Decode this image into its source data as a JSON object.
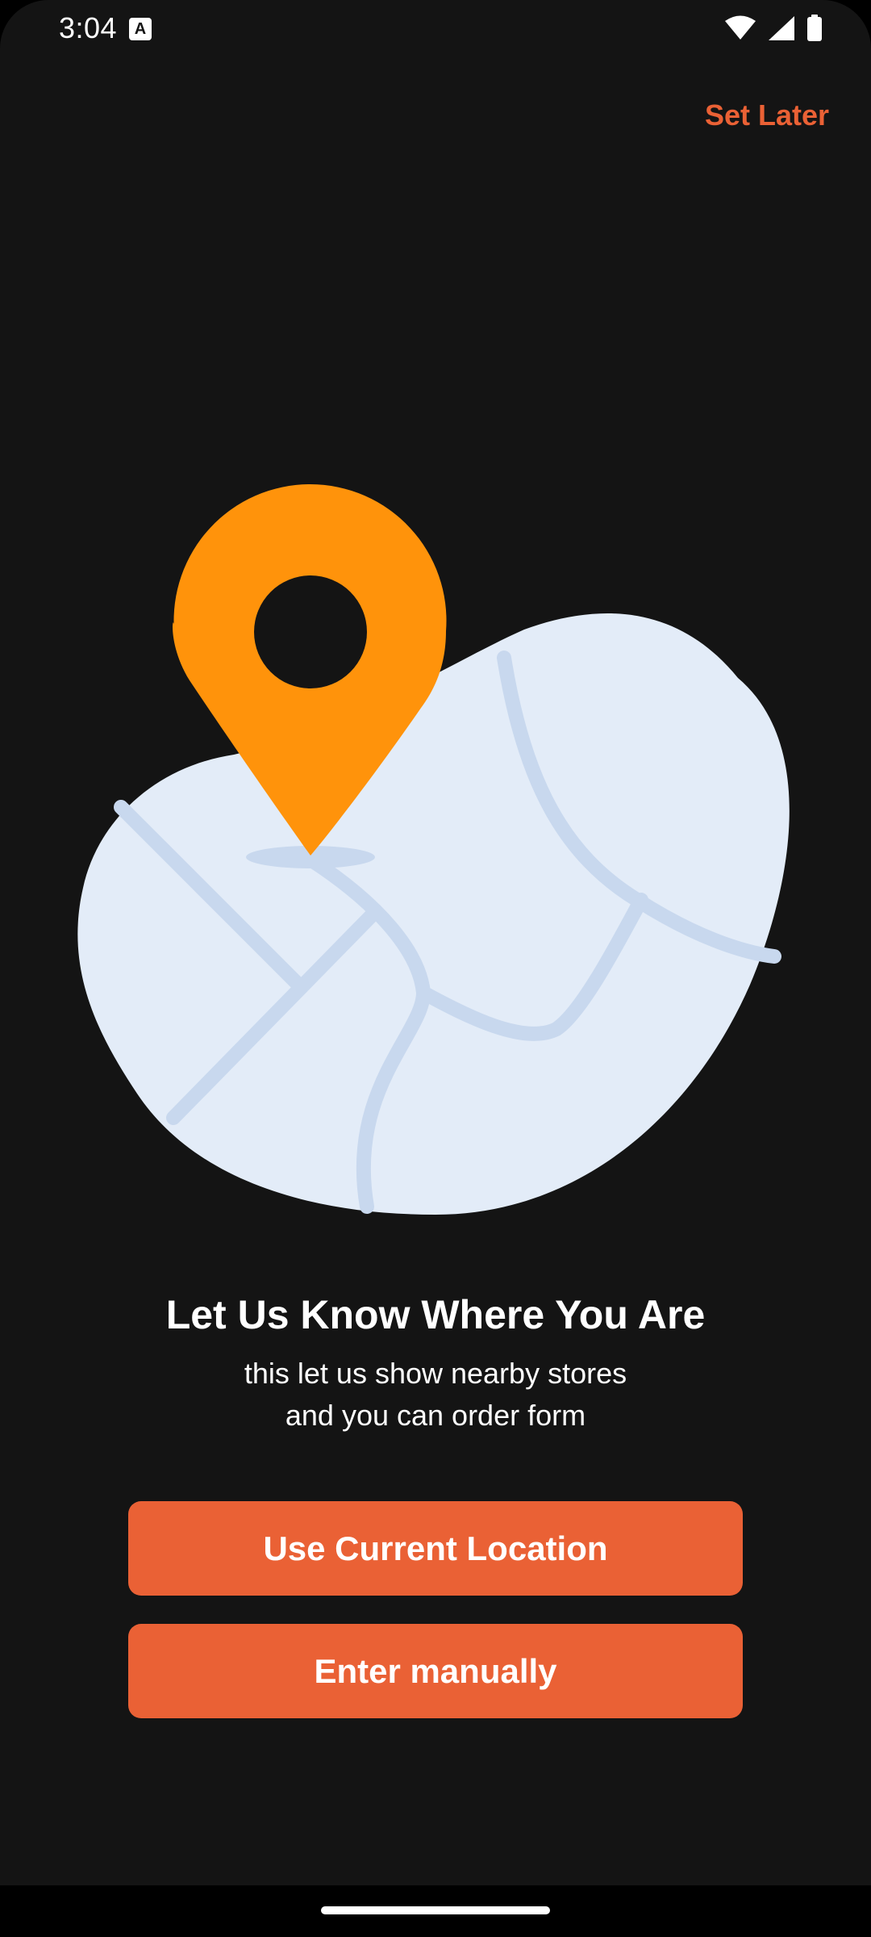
{
  "status_bar": {
    "time": "3:04",
    "notification_icon": "A",
    "icons": [
      "wifi-icon",
      "signal-icon",
      "battery-icon"
    ]
  },
  "header": {
    "skip_label": "Set Later"
  },
  "illustration": {
    "icons": [
      "map-icon",
      "location-pin-icon"
    ]
  },
  "content": {
    "title": "Let Us Know Where You Are",
    "subtitle_line1": "this let us show nearby stores",
    "subtitle_line2": "and you can order form"
  },
  "actions": {
    "current_location_label": "Use Current Location",
    "manual_label": "Enter manually"
  },
  "colors": {
    "accent": "#ea6135",
    "pin": "#ff930b",
    "map_land": "#e3ecf8",
    "map_roads": "#c8d8ee",
    "background": "#141414"
  }
}
